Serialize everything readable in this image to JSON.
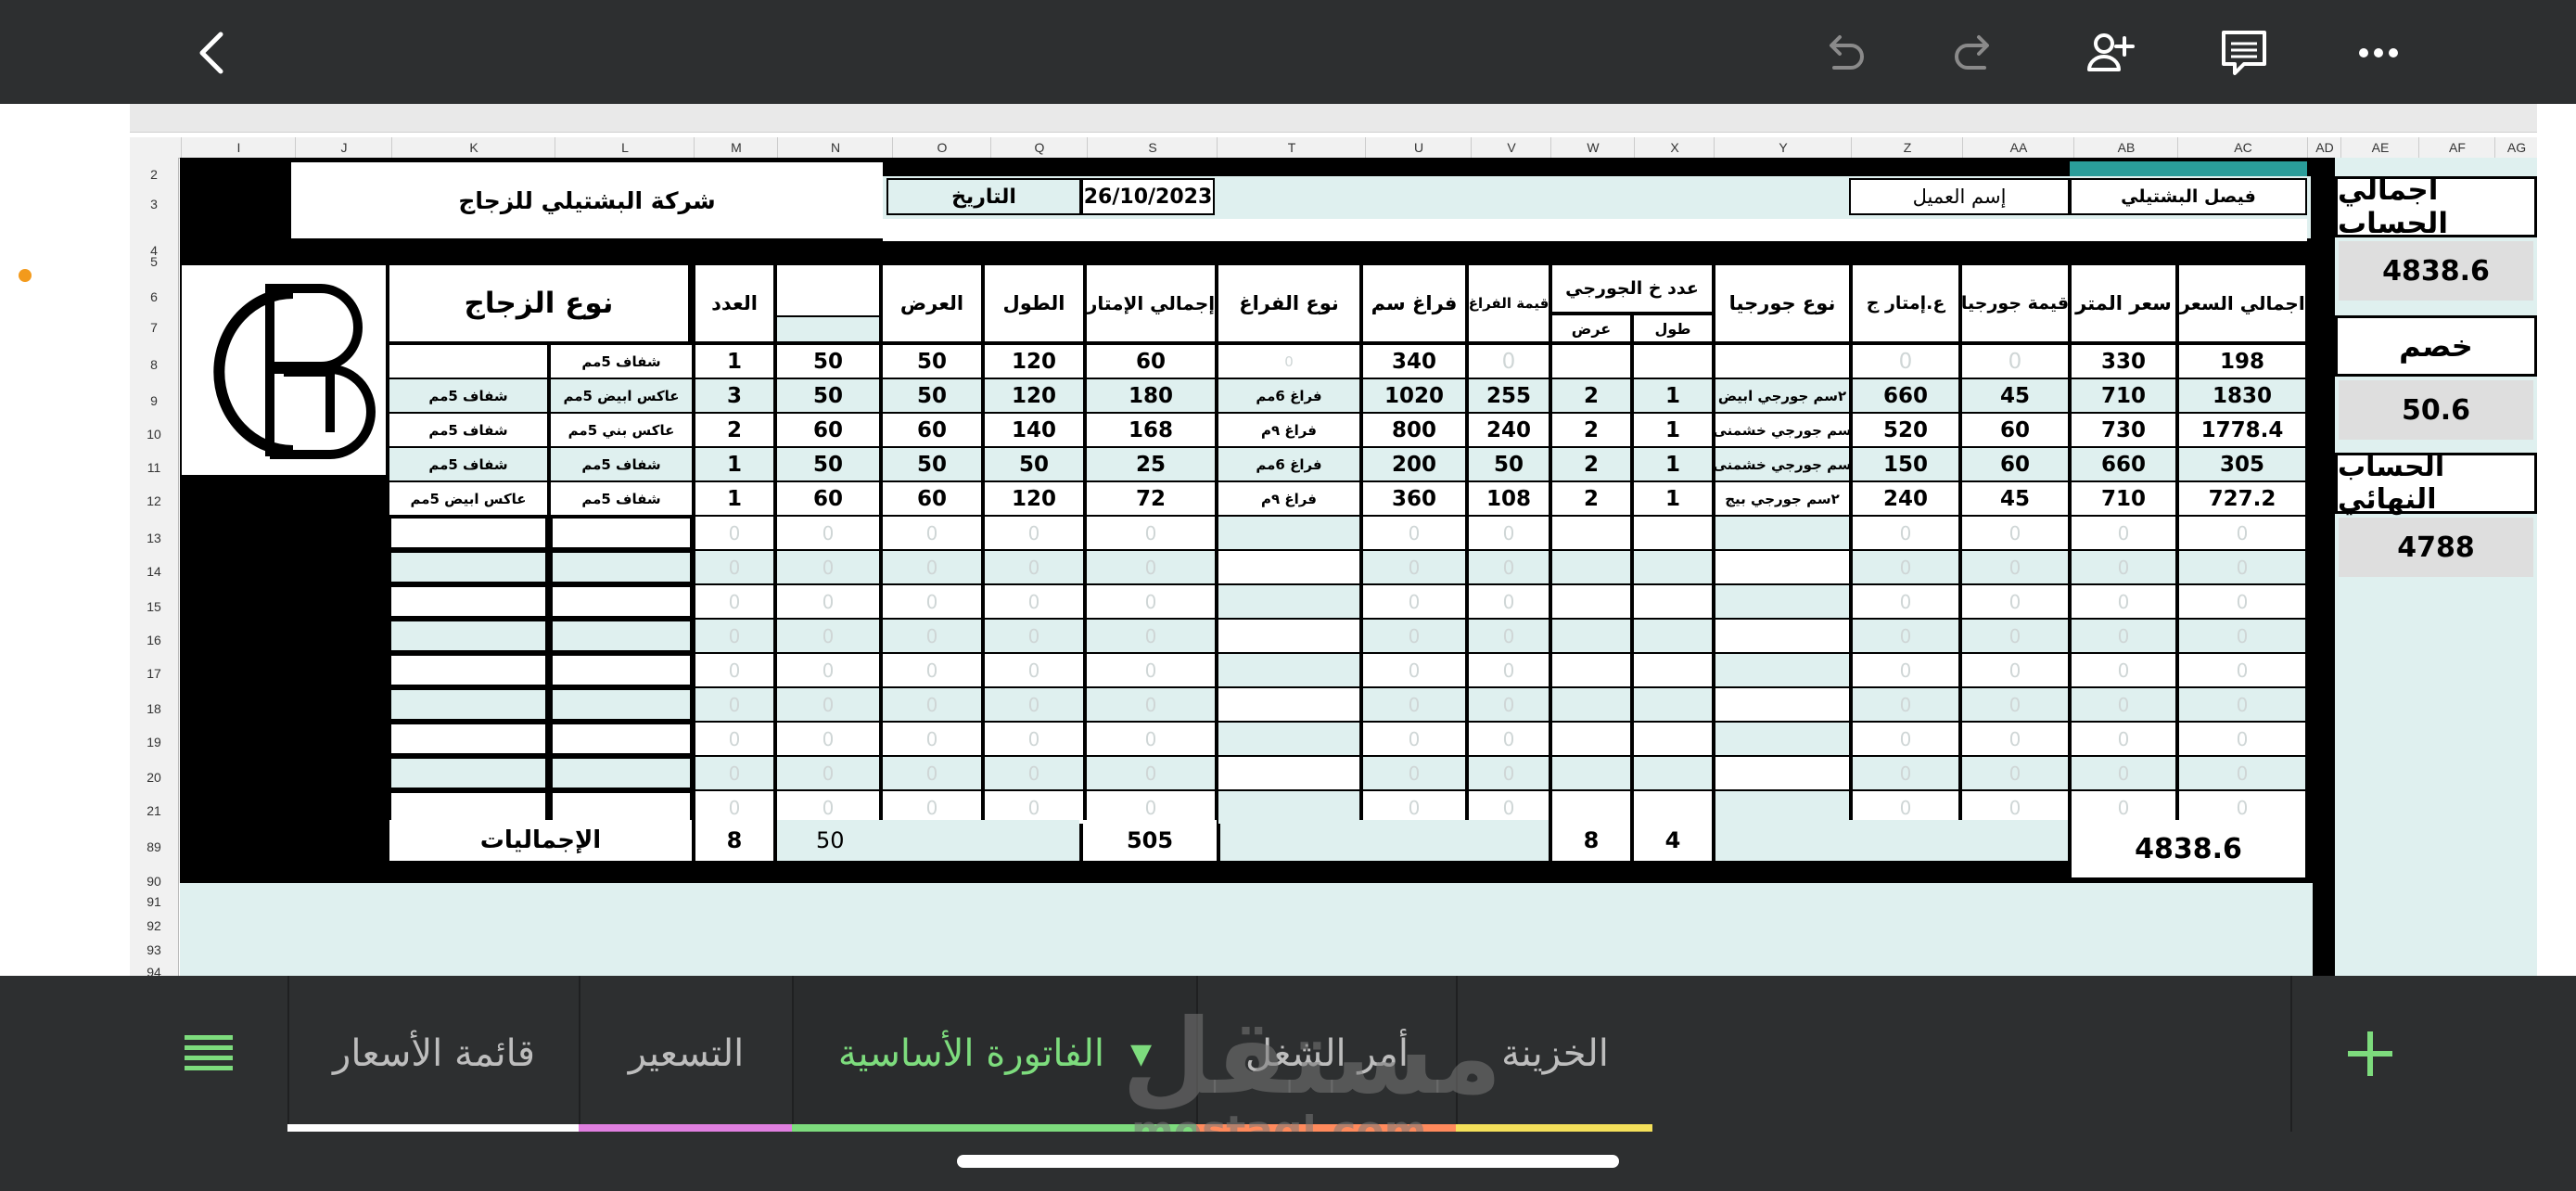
{
  "toolbar": {
    "back_icon": "chevron-left-icon",
    "undo_icon": "undo-icon",
    "redo_icon": "redo-icon",
    "add_person_icon": "add-person-icon",
    "comment_icon": "comment-icon",
    "more_icon": "more-icon"
  },
  "columns": [
    "I",
    "J",
    "K",
    "L",
    "M",
    "N",
    "O",
    "Q",
    "S",
    "T",
    "U",
    "V",
    "W",
    "X",
    "Y",
    "Z",
    "AA",
    "AB",
    "AC",
    "AD",
    "AE",
    "AF",
    "AG"
  ],
  "row_numbers": [
    "2",
    "3",
    "4",
    "5",
    "6",
    "7",
    "8",
    "9",
    "10",
    "11",
    "12",
    "13",
    "14",
    "15",
    "16",
    "17",
    "18",
    "19",
    "20",
    "21",
    "89",
    "90",
    "91",
    "92",
    "93",
    "94"
  ],
  "invoice": {
    "company": "شركة البشتيلي للزجاج",
    "date_label": "التاريخ",
    "date_value": "26/10/2023",
    "client_label": "إسم العميل",
    "client_value": "فيصل البشتيلي",
    "logo_text": "GB",
    "headers": {
      "glass_type": "نوع الزجاج",
      "count": "العدد",
      "width": "العرض",
      "length": "الطول",
      "total_meters": "إجمالي الإمتار",
      "gap_type": "نوع الفراغ",
      "gap_cm": "فراغ سم",
      "gap_value": "قيمة الفراغ",
      "georgian_count": "عدد خ الجورجي",
      "georgian_width": "عرض",
      "georgian_length": "طول",
      "georgian_type": "نوع جورجيا",
      "georgian_meters": "ع.إمتار ج",
      "georgian_value": "قيمة جورجيا",
      "meter_price": "سعر المتر",
      "total_price": "اجمالي السعر"
    },
    "rows": [
      {
        "glass1": "شفاف 5مم",
        "glass2": "",
        "count": "1",
        "n": "50",
        "width": "50",
        "length": "120",
        "total_m": "60",
        "gap_type": "0",
        "gap_cm": "340",
        "gap_val": "0",
        "g_w": "",
        "g_l": "",
        "g_type": "",
        "g_m": "0",
        "g_val": "0",
        "m_price": "330",
        "total": "198"
      },
      {
        "glass1": "عاكس ابيض 5مم",
        "glass2": "شفاف 5مم",
        "count": "3",
        "n": "50",
        "width": "50",
        "length": "120",
        "total_m": "180",
        "gap_type": "فراغ 6مم",
        "gap_cm": "1020",
        "gap_val": "255",
        "g_w": "2",
        "g_l": "1",
        "g_type": "٢سم جورجي ابيض",
        "g_m": "660",
        "g_val": "45",
        "m_price": "710",
        "total": "1830"
      },
      {
        "glass1": "عاكس بني 5مم",
        "glass2": "شفاف 5مم",
        "count": "2",
        "n": "60",
        "width": "60",
        "length": "140",
        "total_m": "168",
        "gap_type": "فراغ ٩م",
        "gap_cm": "800",
        "gap_val": "240",
        "g_w": "2",
        "g_l": "1",
        "g_type": "سم جورجي خشمنى",
        "g_m": "520",
        "g_val": "60",
        "m_price": "730",
        "total": "1778.4"
      },
      {
        "glass1": "شفاف 5مم",
        "glass2": "شفاف 5مم",
        "count": "1",
        "n": "50",
        "width": "50",
        "length": "50",
        "total_m": "25",
        "gap_type": "فراغ 6مم",
        "gap_cm": "200",
        "gap_val": "50",
        "g_w": "2",
        "g_l": "1",
        "g_type": "سم جورجي خشمنى",
        "g_m": "150",
        "g_val": "60",
        "m_price": "660",
        "total": "305"
      },
      {
        "glass1": "شفاف 5مم",
        "glass2": "عاكس ابيض 5مم",
        "count": "1",
        "n": "60",
        "width": "60",
        "length": "120",
        "total_m": "72",
        "gap_type": "فراغ ٩م",
        "gap_cm": "360",
        "gap_val": "108",
        "g_w": "2",
        "g_l": "1",
        "g_type": "٢سم جورجي بيج",
        "g_m": "240",
        "g_val": "45",
        "m_price": "710",
        "total": "727.2"
      }
    ],
    "zero": "0",
    "totals_label": "الإجماليات",
    "totals": {
      "count": "8",
      "n": "50",
      "total_m": "505",
      "g_w": "8",
      "g_l": "4",
      "grand": "4838.6"
    }
  },
  "summary": {
    "total_label": "اجمالي الحساب",
    "total_value": "4838.6",
    "discount_label": "خصم",
    "discount_value": "50.6",
    "final_label": "الحساب النهائي",
    "final_value": "4788"
  },
  "tabs": {
    "menu_icon": "list-menu-icon",
    "items": [
      {
        "label": "قائمة الأسعار",
        "color": "#ffffff"
      },
      {
        "label": "التسعير",
        "color": "#e07fe0"
      },
      {
        "label": "الفاتورة الأساسية",
        "color": "#7ddc7d"
      },
      {
        "label": "أمر الشغل",
        "color": "#ff8a5c"
      },
      {
        "label": "الخزينة",
        "color": "#f4e05a"
      }
    ],
    "add_icon": "plus-icon"
  },
  "watermark": {
    "arabic": "مستقل",
    "latin": "mostaql.com"
  },
  "colors": {
    "teal": "#dff0ef",
    "dark": "#2d2f30",
    "accent_green": "#7ddc7d"
  }
}
